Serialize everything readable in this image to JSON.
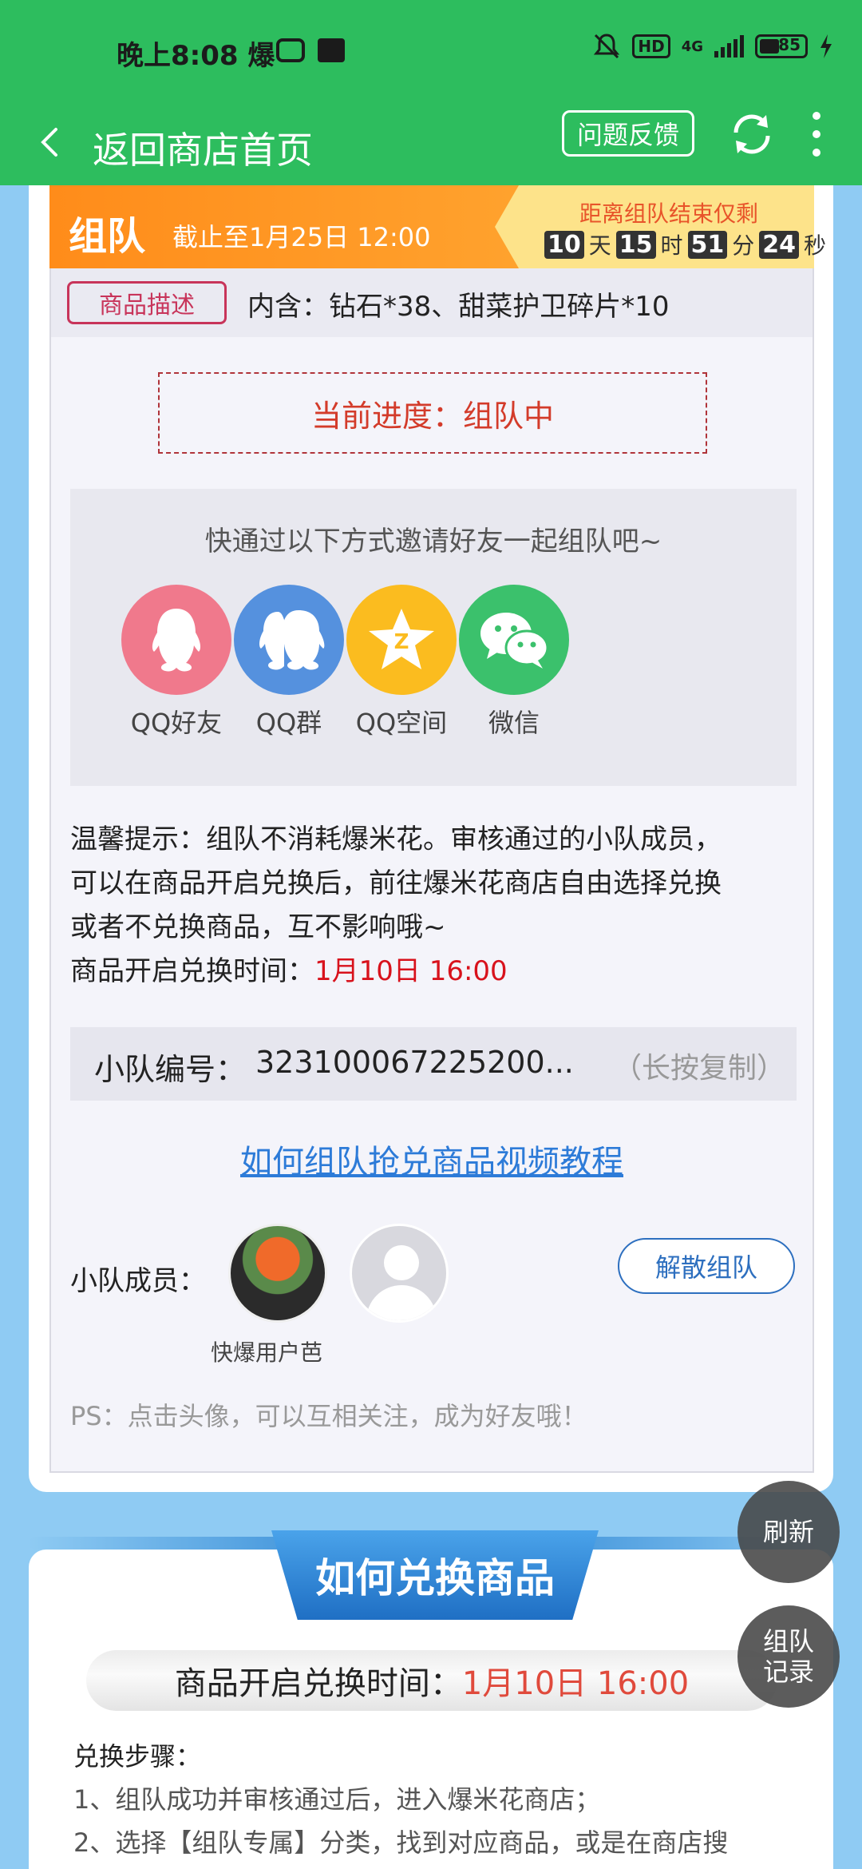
{
  "status_bar": {
    "time": "晚上8:08 爆",
    "network": "HD",
    "network_gen": "4G",
    "battery": "85"
  },
  "nav": {
    "title": "返回商店首页",
    "feedback": "问题反馈"
  },
  "team_banner": {
    "label": "组队",
    "deadline": "截止至1月25日 12:00",
    "countdown_title": "距离组队结束仅剩",
    "days": "10",
    "days_unit": "天",
    "hours": "15",
    "hours_unit": "时",
    "minutes": "51",
    "minutes_unit": "分",
    "seconds": "24",
    "seconds_unit": "秒"
  },
  "description": {
    "tag": "商品描述",
    "text": "内含：钻石*38、甜菜护卫碎片*10"
  },
  "progress": "当前进度：组队中",
  "invite": {
    "title": "快通过以下方式邀请好友一起组队吧~",
    "options": [
      {
        "label": "QQ好友",
        "icon": "qq-icon",
        "color": "#f0798c"
      },
      {
        "label": "QQ群",
        "icon": "qq-group-icon",
        "color": "#5591de"
      },
      {
        "label": "QQ空间",
        "icon": "qzone-icon",
        "color": "#fbbc1f"
      },
      {
        "label": "微信",
        "icon": "wechat-icon",
        "color": "#3bc16c"
      }
    ]
  },
  "tip": {
    "line1": "温馨提示：组队不消耗爆米花。审核通过的小队成员，",
    "line2": "可以在商品开启兑换后，前往爆米花商店自由选择兑换",
    "line3": "或者不兑换商品，互不影响哦~",
    "open_label": "商品开启兑换时间：",
    "open_time": "1月10日 16:00"
  },
  "team_id": {
    "label": "小队编号：",
    "value": "323100067225200...",
    "copy_hint": "（长按复制）"
  },
  "video_link": "如何组队抢兑商品视频教程",
  "members": {
    "label": "小队成员：",
    "member_name": "快爆用户芭",
    "disband": "解散组队"
  },
  "ps": "PS：点击头像，可以互相关注，成为好友哦！",
  "how_to": {
    "title": "如何兑换商品",
    "open_label": "商品开启兑换时间：",
    "open_time": "1月10日 16:00",
    "steps_title": "兑换步骤：",
    "step1": "1、组队成功并审核通过后，进入爆米花商店；",
    "step2": "2、选择【组队专属】分类，找到对应商品，或是在商店搜"
  },
  "floating": {
    "refresh": "刷新",
    "records_line1": "组队",
    "records_line2": "记录"
  }
}
